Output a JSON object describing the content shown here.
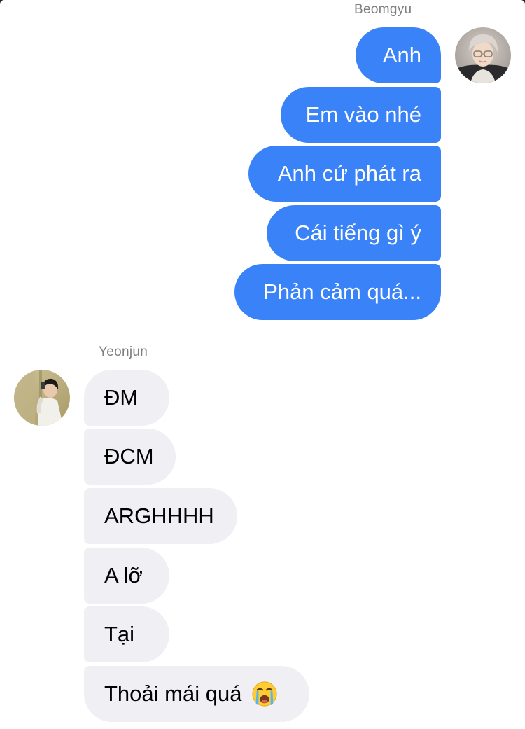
{
  "conversation": {
    "participants": {
      "right": {
        "name": "Beomgyu",
        "avatar_icon": "avatar-photo-beomgyu"
      },
      "left": {
        "name": "Yeonjun",
        "avatar_icon": "avatar-photo-yeonjun"
      }
    },
    "outgoing_messages": [
      {
        "text": "Anh"
      },
      {
        "text": "Em vào nhé"
      },
      {
        "text": "Anh cứ phát ra"
      },
      {
        "text": "Cái tiếng gì ý"
      },
      {
        "text": "Phản cảm quá..."
      }
    ],
    "incoming_messages": [
      {
        "text": "ĐM"
      },
      {
        "text": "ĐCM"
      },
      {
        "text": "ARGHHHH"
      },
      {
        "text": "A lỡ"
      },
      {
        "text": "Tại"
      },
      {
        "text": "Thoải mái quá",
        "emoji_icon": "loudly-crying-face-icon"
      }
    ]
  },
  "colors": {
    "outgoing_bubble": "#3a82f7",
    "incoming_bubble": "#efeff4",
    "sender_name": "#7d7d82",
    "background": "#ffffff"
  }
}
